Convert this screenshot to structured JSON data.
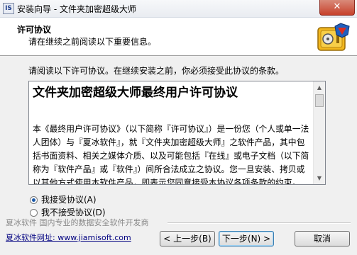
{
  "window": {
    "title": "安装向导 - 文件夹加密超级大师",
    "close_label": "✕"
  },
  "header": {
    "title": "许可协议",
    "subtitle": "请在继续之前阅读以下重要信息。"
  },
  "intro": "请阅读以下许可协议。在继续安装之前，你必须接受此协议的条款。",
  "license": {
    "heading": "文件夹加密超级大师最终用户许可协议",
    "body": "本《最终用户许可协议》（以下简称『许可协议』）是一份您（个人或单一法人团体）与『夏冰软件』，就『文件夹加密超级大师』之软件产品，其中包括书面资料、相关之媒体介质、以及可能包括『在线』或电子文档（以下简称为『软件产品』或『软件』）间所合法成立之协议。您一旦安装、拷贝或以其他方式使用本软件产品，即表示您同意接受本协议各项条款的约束。"
  },
  "options": {
    "accept": "我接受协议(A)",
    "decline": "我不接受协议(D)",
    "selected": "accept"
  },
  "footer": {
    "brand": "夏冰软件 国内专业的数据安全软件开发商",
    "website": "夏冰软件网址: www.jiamisoft.com"
  },
  "buttons": {
    "back": "< 上一步(B)",
    "next": "下一步(N) >",
    "cancel": "取消"
  },
  "colors": {
    "link": "#000080",
    "close": "#c7412b",
    "radio_dot": "#1a58a8"
  }
}
